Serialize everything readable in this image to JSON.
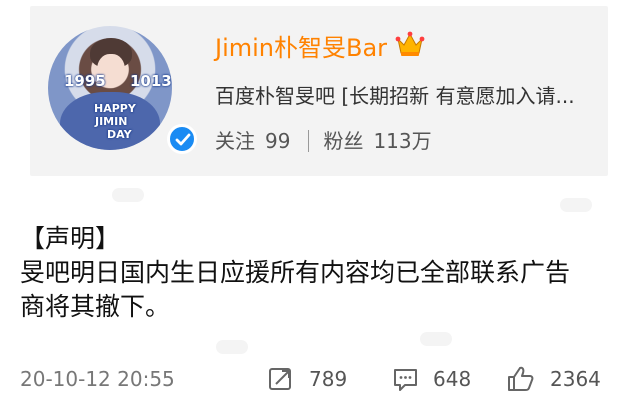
{
  "profile": {
    "name": "Jimin朴智旻Bar",
    "description": "百度朴智旻吧 [长期招新 有意愿加入请...",
    "avatar_text": {
      "year_left": "1995",
      "year_right": "1013",
      "line1": "HAPPY",
      "line2": "JIMIN",
      "line3": "DAY"
    },
    "following_label": "关注",
    "following_count": "99",
    "followers_label": "粉丝",
    "followers_count": "113万",
    "name_color": "#ff8200",
    "verified_color": "#1a8bf3",
    "crown_color": "#ffb400"
  },
  "post": {
    "lines": [
      "【声明】",
      "旻吧明日国内生日应援所有内容均已全部联系广告",
      "商将其撤下。"
    ]
  },
  "footer": {
    "timestamp": "20-10-12 20:55",
    "repost_count": "789",
    "comment_count": "648",
    "like_count": "2364"
  }
}
